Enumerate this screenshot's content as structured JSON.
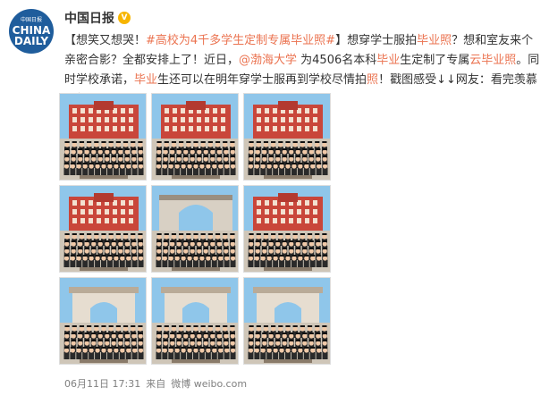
{
  "account": {
    "logo_top": "中国日报",
    "logo_line1": "CHINA",
    "logo_line2": "DAILY",
    "name": "中国日报",
    "verified_icon": "verified-v-icon"
  },
  "post": {
    "seg1": "【想笑又想哭！",
    "hashtag": "#高校为4千多学生定制专属毕业照#",
    "seg2": "】想穿学士服拍",
    "hl1": "毕业照",
    "seg3": "？想和室友来个亲密合影？全都安排上了！近日，",
    "mention": "@渤海大学",
    "seg4": " 为4506名本科",
    "hl2": "毕业",
    "seg5": "生定制了专属",
    "hl3": "云毕业照",
    "seg6": "。同时学校承诺，",
    "hl4": "毕业",
    "seg7": "生还可以在明年穿学士服再到学校尽情拍",
    "hl5": "照",
    "seg8": "！戳图感受↓↓网友：看完羡慕又想哭。"
  },
  "images": [
    {
      "bg": "building"
    },
    {
      "bg": "building"
    },
    {
      "bg": "building"
    },
    {
      "bg": "building"
    },
    {
      "bg": "gate"
    },
    {
      "bg": "building"
    },
    {
      "bg": "arch"
    },
    {
      "bg": "arch"
    },
    {
      "bg": "arch"
    }
  ],
  "footer": {
    "date": "06月11日 17:31",
    "source_prefix": "来自",
    "source": "微博 weibo.com"
  },
  "colors": {
    "link": "#eb7350",
    "sky": "#8fc6ea",
    "building": "#c9463a",
    "gown": "#2a2a2a"
  }
}
